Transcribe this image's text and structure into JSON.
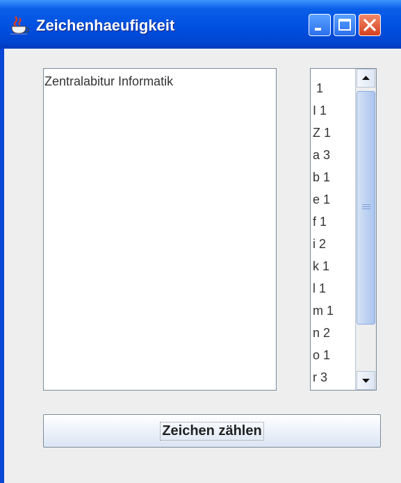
{
  "window": {
    "title": "Zeichenhaeufigkeit",
    "icon": "java-coffee-cup-icon",
    "controls": [
      "minimize-icon",
      "maximize-icon",
      "close-icon"
    ]
  },
  "text_area": {
    "value": "Zentralabitur Informatik"
  },
  "frequency_list": {
    "items": [
      " 1",
      "I 1",
      "Z 1",
      "a 3",
      "b 1",
      "e 1",
      "f 1",
      "i 2",
      "k 1",
      "l 1",
      "m 1",
      "n 2",
      "o 1",
      "r 3"
    ]
  },
  "count_button": {
    "label": "Zeichen zählen"
  },
  "colors": {
    "titlebar": "#0050e0",
    "close_button": "#d4411e",
    "client_background": "#eeeeee"
  }
}
